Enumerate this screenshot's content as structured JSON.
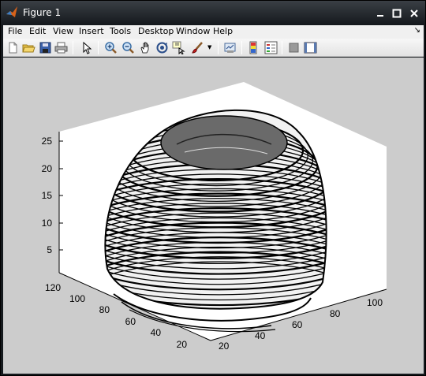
{
  "window": {
    "title": "Figure 1"
  },
  "menu": {
    "items": [
      "File",
      "Edit",
      "View",
      "Insert",
      "Tools",
      "Desktop",
      "Window",
      "Help"
    ]
  },
  "toolbar": {
    "icons": [
      "new-figure-icon",
      "open-file-icon",
      "save-icon",
      "print-icon",
      "edit-plot-arrow-icon",
      "zoom-in-icon",
      "zoom-out-icon",
      "pan-hand-icon",
      "rotate-3d-icon",
      "data-cursor-icon",
      "brush-icon",
      "link-plot-icon",
      "colorbar-icon",
      "legend-icon",
      "hide-plot-tools-icon",
      "show-plot-tools-icon"
    ]
  },
  "axes": {
    "z_ticks": [
      "25",
      "20",
      "15",
      "10",
      "5"
    ],
    "y_ticks": [
      "120",
      "100",
      "80",
      "60",
      "40",
      "20"
    ],
    "x_ticks": [
      "20",
      "40",
      "60",
      "80",
      "100"
    ]
  }
}
